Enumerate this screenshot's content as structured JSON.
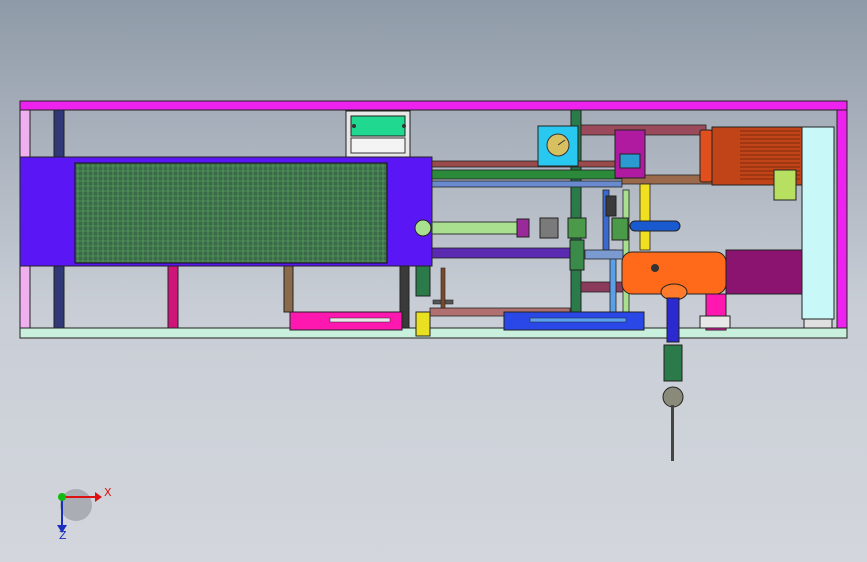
{
  "view": {
    "background_top": "#8f9aa8",
    "background_bottom": "#d3d6dc"
  },
  "triad": {
    "x_label": "X",
    "z_label": "Z",
    "x_color": "#dd1111",
    "y_color": "#11bb11",
    "z_color": "#1a2fbd"
  },
  "model": {
    "frame_color": "#ee22ee",
    "base_color": "#c8f0dc",
    "cooler_color": "#5a16f5",
    "mesh_color": "#2f6a2f",
    "motor_color": "#e0501e",
    "tank_color": "#ff6a1a",
    "purple_cylinder_color": "#8a1470",
    "panel_color": "#20d890",
    "skid_magenta": "#ff18b0",
    "skid_blue": "#2a48e8",
    "pipe_green": "#a8e090",
    "pipe_dark_green": "#2a7a3a",
    "pipe_brown": "#9a5a4a",
    "pipe_yellow": "#f0e020",
    "cabinet_cyan": "#c8f8f8",
    "gauge_box_cyan": "#28c8f0"
  }
}
